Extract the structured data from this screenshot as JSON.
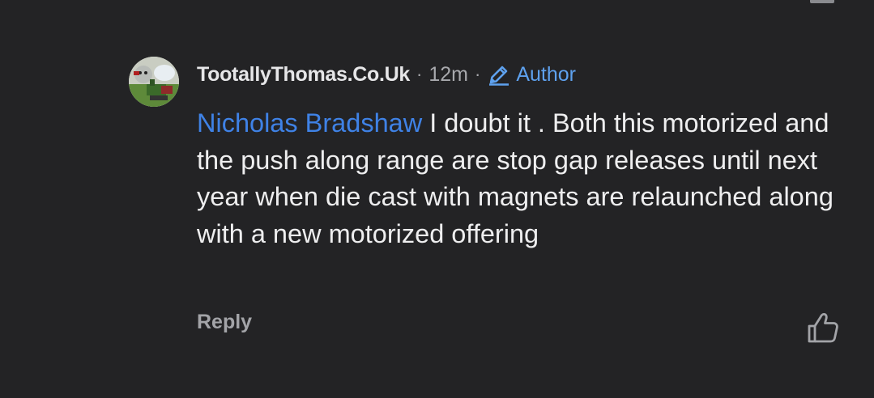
{
  "comment": {
    "author": "TootallyThomas.Co.Uk",
    "separator": "·",
    "time": "12m",
    "badge_icon": "pencil-icon",
    "badge_label": "Author",
    "mention": "Nicholas Bradshaw",
    "text": " I doubt it . Both this motorized and the push along range are stop gap releases until next year when die cast with magnets are relaunched along with a new motorized offering",
    "reply_label": "Reply",
    "like_icon": "thumbs-up-icon"
  },
  "colors": {
    "background": "#232325",
    "text": "#eeeeef",
    "meta": "#a8a9ad",
    "mention": "#3f82e6",
    "badge": "#5ea1ee"
  }
}
